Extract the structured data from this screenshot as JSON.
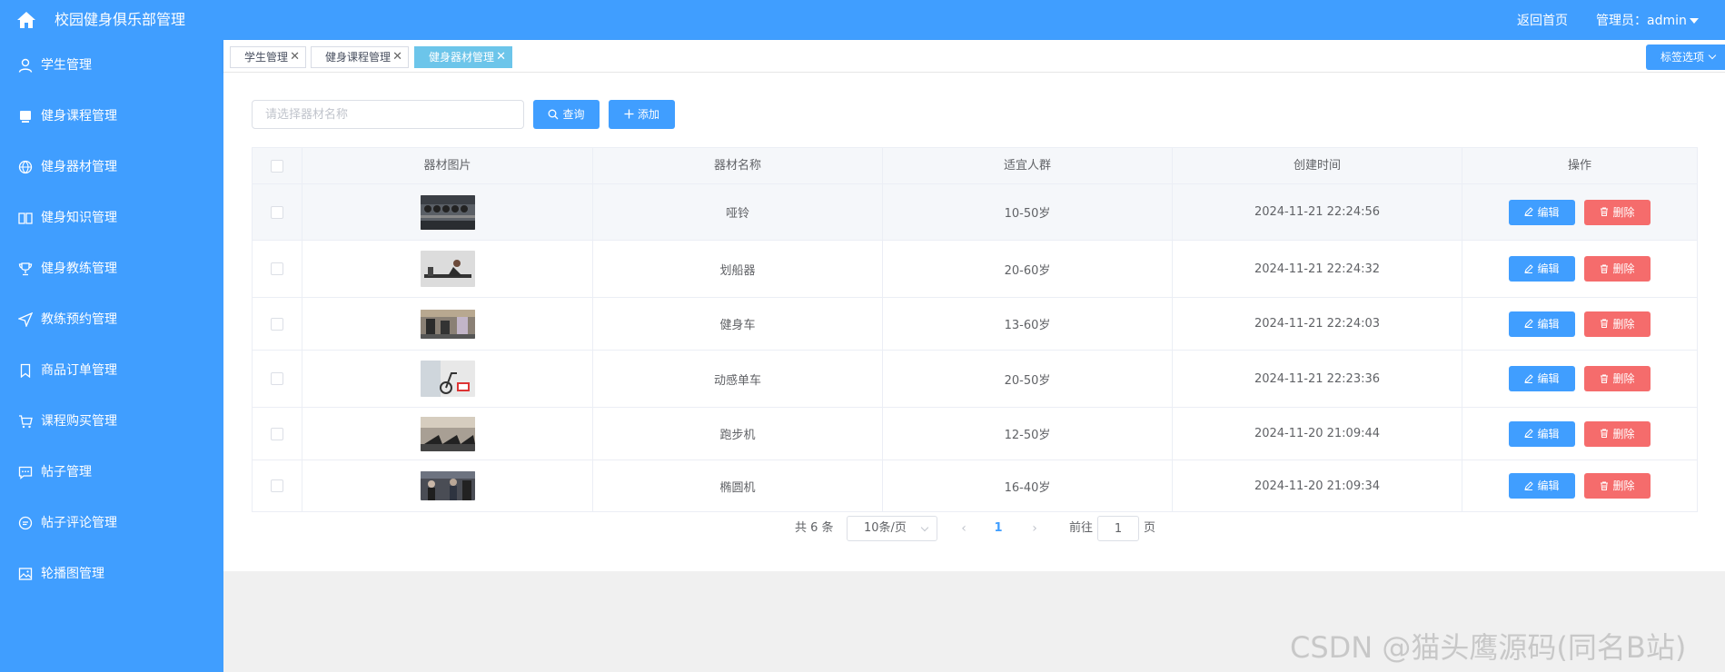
{
  "header": {
    "title": "校园健身俱乐部管理",
    "back_home": "返回首页",
    "admin_prefix": "管理员：",
    "admin_name": "admin"
  },
  "sidebar": {
    "items": [
      {
        "label": "学生管理",
        "icon": "user-icon"
      },
      {
        "label": "健身课程管理",
        "icon": "course-icon"
      },
      {
        "label": "健身器材管理",
        "icon": "basketball-icon"
      },
      {
        "label": "健身知识管理",
        "icon": "book-icon"
      },
      {
        "label": "健身教练管理",
        "icon": "trophy-icon"
      },
      {
        "label": "教练预约管理",
        "icon": "send-icon"
      },
      {
        "label": "商品订单管理",
        "icon": "bookmark-icon"
      },
      {
        "label": "课程购买管理",
        "icon": "cart-icon"
      },
      {
        "label": "帖子管理",
        "icon": "chat-dots-icon"
      },
      {
        "label": "帖子评论管理",
        "icon": "chat-bubble-icon"
      },
      {
        "label": "轮播图管理",
        "icon": "picture-icon"
      }
    ]
  },
  "tags": {
    "items": [
      {
        "label": "学生管理",
        "active": false
      },
      {
        "label": "健身课程管理",
        "active": false
      },
      {
        "label": "健身器材管理",
        "active": true
      }
    ],
    "options_label": "标签选项"
  },
  "search": {
    "placeholder": "请选择器材名称",
    "value": "",
    "query_label": "查询",
    "add_label": "添加"
  },
  "table": {
    "columns": [
      "器材图片",
      "器材名称",
      "适宜人群",
      "创建时间",
      "操作"
    ],
    "edit_label": "编辑",
    "delete_label": "删除",
    "rows": [
      {
        "name": "哑铃",
        "crowd": "10-50岁",
        "created": "2024-11-21 22:24:56"
      },
      {
        "name": "划船器",
        "crowd": "20-60岁",
        "created": "2024-11-21 22:24:32"
      },
      {
        "name": "健身车",
        "crowd": "13-60岁",
        "created": "2024-11-21 22:24:03"
      },
      {
        "name": "动感单车",
        "crowd": "20-50岁",
        "created": "2024-11-21 22:23:36"
      },
      {
        "name": "跑步机",
        "crowd": "12-50岁",
        "created": "2024-11-20 21:09:44"
      },
      {
        "name": "椭圆机",
        "crowd": "16-40岁",
        "created": "2024-11-20 21:09:34"
      }
    ]
  },
  "pagination": {
    "total_text": "共 6 条",
    "page_size": "10条/页",
    "current_page": "1",
    "goto_label": "前往",
    "goto_value": "1",
    "page_unit": "页"
  },
  "watermark": "CSDN @猫头鹰源码(同名B站)",
  "colors": {
    "primary": "#409eff",
    "danger": "#f56c6c",
    "active_tag": "#6cc5ea"
  }
}
